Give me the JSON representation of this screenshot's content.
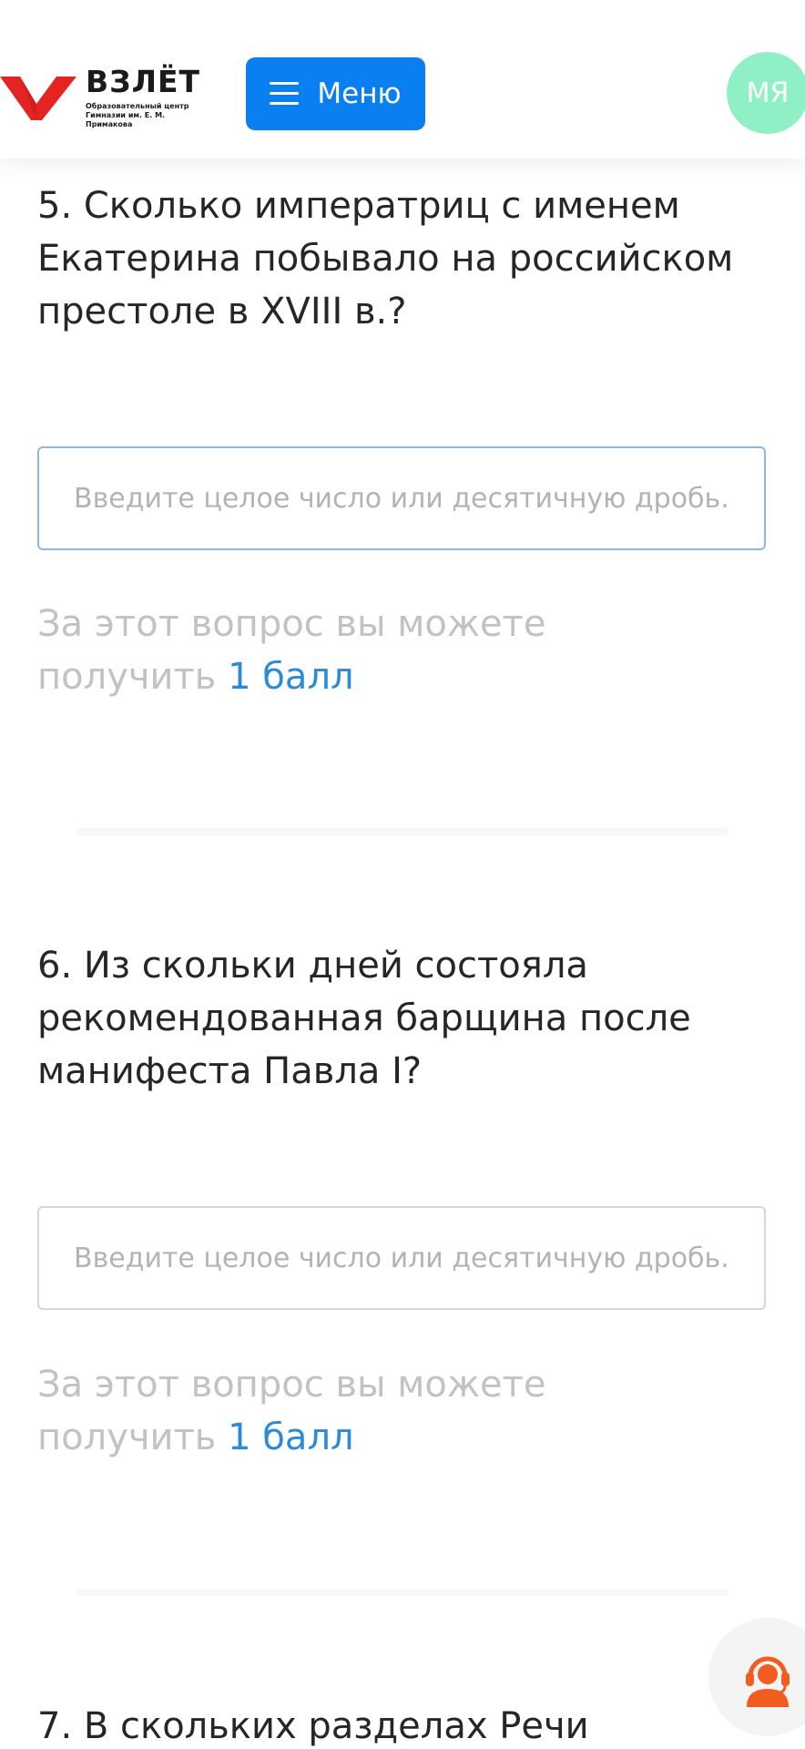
{
  "header": {
    "logo_title": "ВЗЛЁТ",
    "logo_subtitle_line1": "Образовательный центр",
    "logo_subtitle_line2": "Гимназии им. Е. М. Примакова",
    "menu_label": "Меню",
    "avatar_initials": "МЯ"
  },
  "questions": [
    {
      "text": "5. Сколько императриц с именем Екатерина побывало на российском престоле в XVIII в.?",
      "placeholder": "Введите целое число или десятичную дробь...",
      "points_prefix": "За этот вопрос вы можете получить",
      "points_value": "1 балл"
    },
    {
      "text": "6. Из скольки дней состояла рекомендованная барщина после манифеста Павла I?",
      "placeholder": "Введите целое число или десятичную дробь...",
      "points_prefix": "За этот вопрос вы можете получить",
      "points_value": "1 балл"
    },
    {
      "text": "7. В скольких разделах Речи"
    }
  ],
  "colors": {
    "brand_red": "#e52421",
    "menu_blue": "#0a7ff2",
    "avatar_green": "#8ff0c6",
    "points_blue": "#2c8ad8",
    "support_orange": "#f25c1f"
  },
  "icons": {
    "menu": "hamburger-icon",
    "support": "support-headset-icon",
    "logo": "checkmark-logo-icon"
  }
}
